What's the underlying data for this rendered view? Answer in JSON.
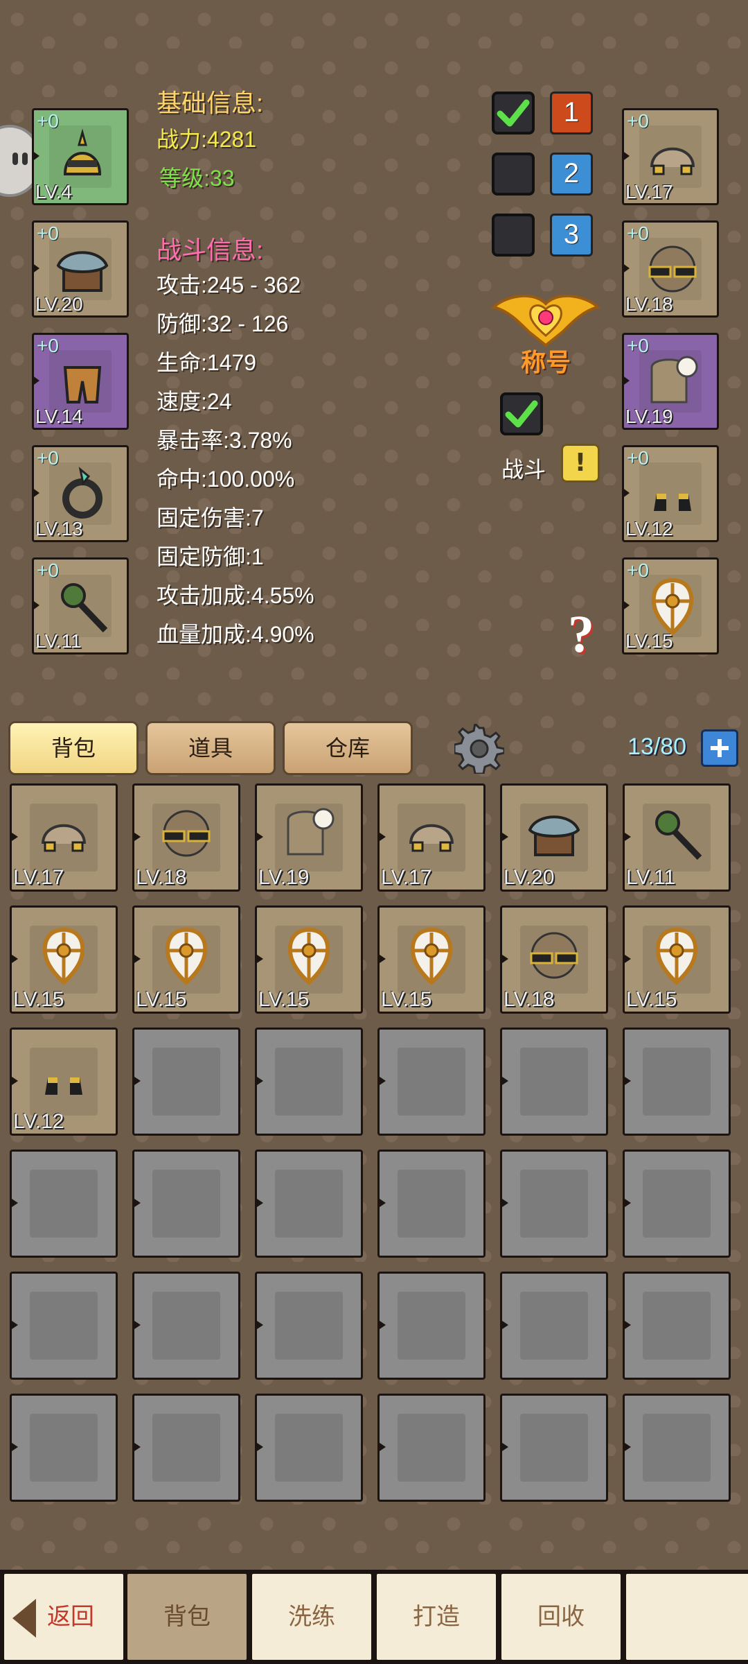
{
  "basic": {
    "header": "基础信息:",
    "power": "战力:4281",
    "level": "等级:33"
  },
  "battle": {
    "header": "战斗信息:",
    "stats": [
      "攻击:245 - 362",
      "防御:32 - 126",
      "生命:1479",
      "速度:24",
      "暴击率:3.78%",
      "命中:100.00%",
      "固定伤害:7",
      "固定防御:1",
      "攻击加成:4.55%",
      "血量加成:4.90%"
    ]
  },
  "left_equip": [
    {
      "plus": "+0",
      "lv": "LV.4",
      "color": "green",
      "icon": "helmet-icon"
    },
    {
      "plus": "+0",
      "lv": "LV.20",
      "color": "tan",
      "icon": "fur-armor-icon"
    },
    {
      "plus": "+0",
      "lv": "LV.14",
      "color": "purple",
      "icon": "pants-icon"
    },
    {
      "plus": "+0",
      "lv": "LV.13",
      "color": "tan",
      "icon": "ring-icon"
    },
    {
      "plus": "+0",
      "lv": "LV.11",
      "color": "tan",
      "icon": "mace-icon"
    }
  ],
  "right_equip": [
    {
      "plus": "+0",
      "lv": "LV.17",
      "color": "tan",
      "icon": "gloves-icon"
    },
    {
      "plus": "+0",
      "lv": "LV.18",
      "color": "tan",
      "icon": "sunglasses-icon"
    },
    {
      "plus": "+0",
      "lv": "LV.19",
      "color": "purple",
      "icon": "cloak-icon"
    },
    {
      "plus": "+0",
      "lv": "LV.12",
      "color": "tan",
      "icon": "boots-icon"
    },
    {
      "plus": "+0",
      "lv": "LV.15",
      "color": "tan",
      "icon": "shield-icon"
    }
  ],
  "presets": [
    "1",
    "2",
    "3"
  ],
  "title_label": "称号",
  "battle_label": "战斗",
  "tabs": [
    "背包",
    "道具",
    "仓库"
  ],
  "capacity": "13/80",
  "inventory": [
    {
      "lv": "LV.17",
      "icon": "gloves-icon"
    },
    {
      "lv": "LV.18",
      "icon": "sunglasses-icon"
    },
    {
      "lv": "LV.19",
      "icon": "cloak-icon"
    },
    {
      "lv": "LV.17",
      "icon": "gloves-icon"
    },
    {
      "lv": "LV.20",
      "icon": "fur-armor-icon"
    },
    {
      "lv": "LV.11",
      "icon": "mace-icon"
    },
    {
      "lv": "LV.15",
      "icon": "shield-icon"
    },
    {
      "lv": "LV.15",
      "icon": "shield-icon"
    },
    {
      "lv": "LV.15",
      "icon": "shield-icon"
    },
    {
      "lv": "LV.15",
      "icon": "shield-icon"
    },
    {
      "lv": "LV.18",
      "icon": "sunglasses-icon"
    },
    {
      "lv": "LV.15",
      "icon": "shield-icon"
    },
    {
      "lv": "LV.12",
      "icon": "boots-icon"
    }
  ],
  "bottom_nav": {
    "back": "返回",
    "items": [
      "背包",
      "洗练",
      "打造",
      "回收",
      ""
    ]
  }
}
